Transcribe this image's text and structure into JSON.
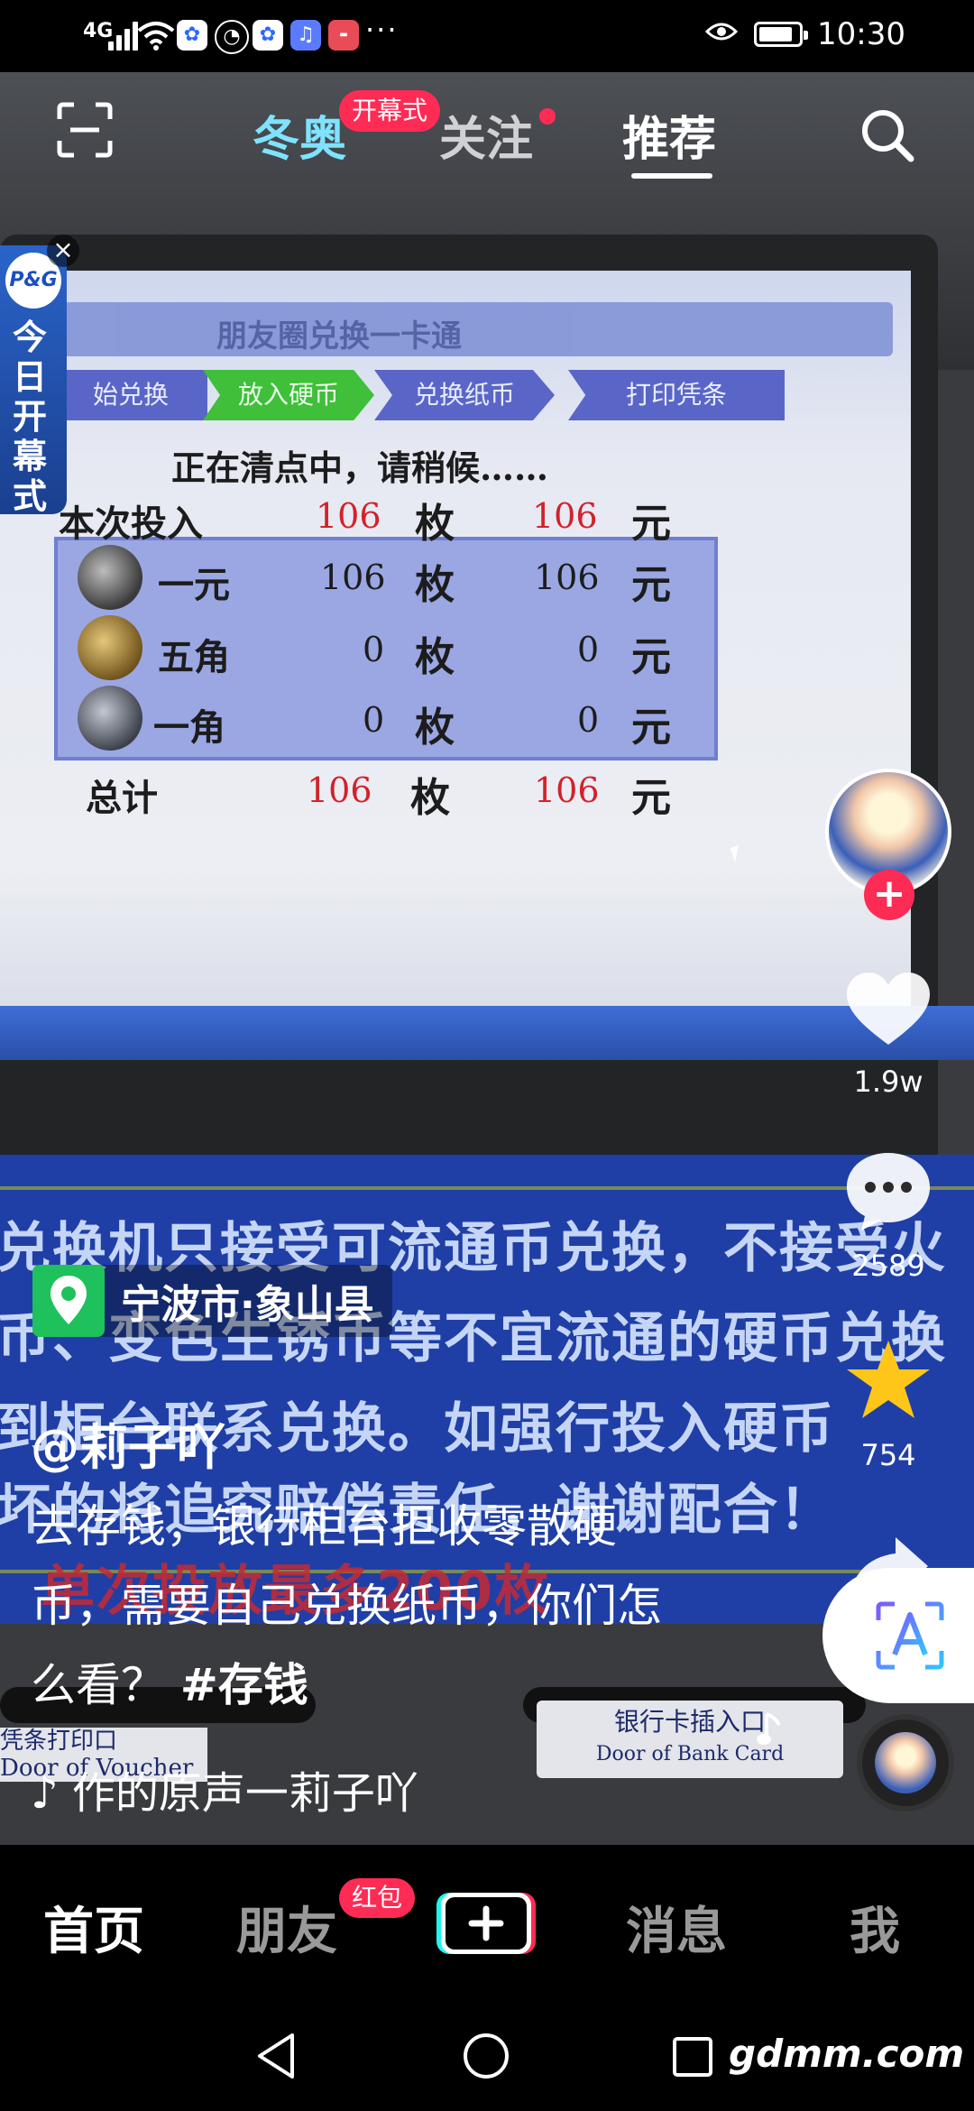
{
  "status_bar": {
    "signal": "4G",
    "time": "10:30",
    "more": "···",
    "app_icons": [
      "baidu-icon",
      "clock-app-icon",
      "baidu-icon",
      "music-app-icon",
      "huawei-app-icon"
    ]
  },
  "top_nav": {
    "tabs": [
      {
        "label": "冬奥",
        "badge": "开幕式"
      },
      {
        "label": "关注",
        "has_dot": true
      },
      {
        "label": "推荐",
        "active": true
      }
    ]
  },
  "ad": {
    "brand": "P&G",
    "text": "今日开幕式"
  },
  "video": {
    "screen_header": "朋友圈兑换一卡通",
    "steps": [
      "始兑换",
      "放入硬币",
      "兑换纸币",
      "打印凭条"
    ],
    "counting_text": "正在清点中，请稍候……",
    "rows": [
      {
        "label": "本次投入",
        "count": "106",
        "unit_count": "枚",
        "amount": "106",
        "unit_amount": "元"
      },
      {
        "label": "一元",
        "count": "106",
        "unit_count": "枚",
        "amount": "106",
        "unit_amount": "元"
      },
      {
        "label": "五角",
        "count": "0",
        "unit_count": "枚",
        "amount": "0",
        "unit_amount": "元"
      },
      {
        "label": "一角",
        "count": "0",
        "unit_count": "枚",
        "amount": "0",
        "unit_amount": "元"
      },
      {
        "label": "总计",
        "count": "106",
        "unit_count": "枚",
        "amount": "106",
        "unit_amount": "元"
      }
    ],
    "panel_lines": [
      "兑换机只接受可流通币兑换，不接受火",
      "币、变色生锈币等不宜流通的硬币兑换",
      "到柜台联系兑换。如强行投入硬币",
      "坏的将追究赔偿责任，谢谢配合！"
    ],
    "panel_warning": "单次投放最多200枚",
    "card_slot_label": "银行卡插入口",
    "card_slot_label_en": "Door of Bank Card",
    "voucher_label": "凭条打印口",
    "voucher_label_en": "Door of Voucher"
  },
  "actions": {
    "likes": "1.9w",
    "comments": "2589",
    "favorites": "754"
  },
  "post": {
    "location": "宁波市·象山县",
    "author": "@莉子吖",
    "caption": "去存钱，银行柜台拒收零散硬币，需要自己兑换纸币，你们怎么看？",
    "hashtag": "#存钱",
    "music": "作的原声一莉子吖"
  },
  "bottom_tabs": {
    "home": "首页",
    "friends": "朋友",
    "friends_badge": "红包",
    "messages": "消息",
    "me": "我"
  },
  "watermark": "gdmm.com",
  "colors": {
    "accent": "#fe2c55",
    "olympics_tab": "#7fe3ff",
    "location_green": "#1ec15b",
    "favorite_star": "#ffc61a"
  }
}
